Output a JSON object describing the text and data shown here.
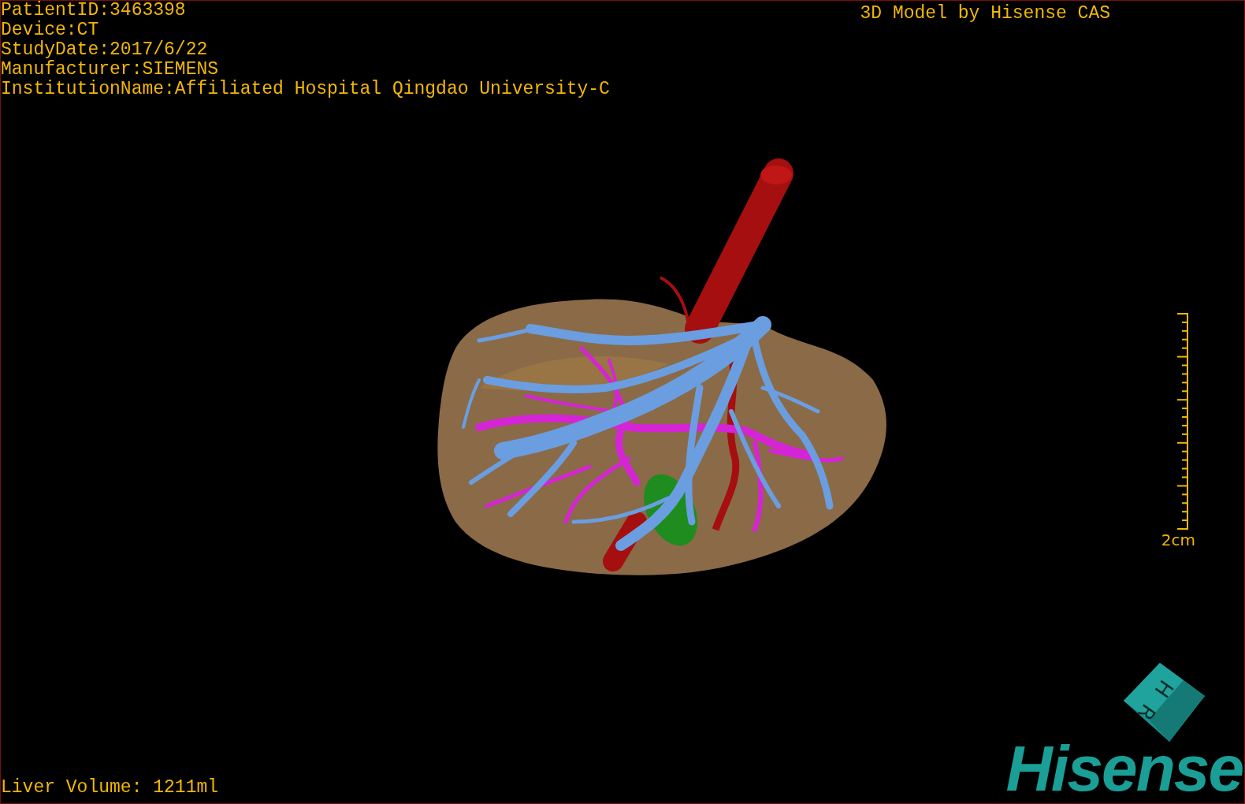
{
  "overlay": {
    "patient_info": [
      "PatientID:3463398",
      "Device:CT",
      "StudyDate:2017/6/22",
      "Manufacturer:SIEMENS",
      "InstitutionName:Affiliated Hospital Qingdao University-C"
    ],
    "title": "3D Model by Hisense CAS"
  },
  "scale_bar": {
    "label": "2cm"
  },
  "orientation_cube": {
    "labels": [
      "H",
      "R"
    ]
  },
  "liver_volume": "Liver Volume: 1211ml",
  "logo": "Hisense"
}
